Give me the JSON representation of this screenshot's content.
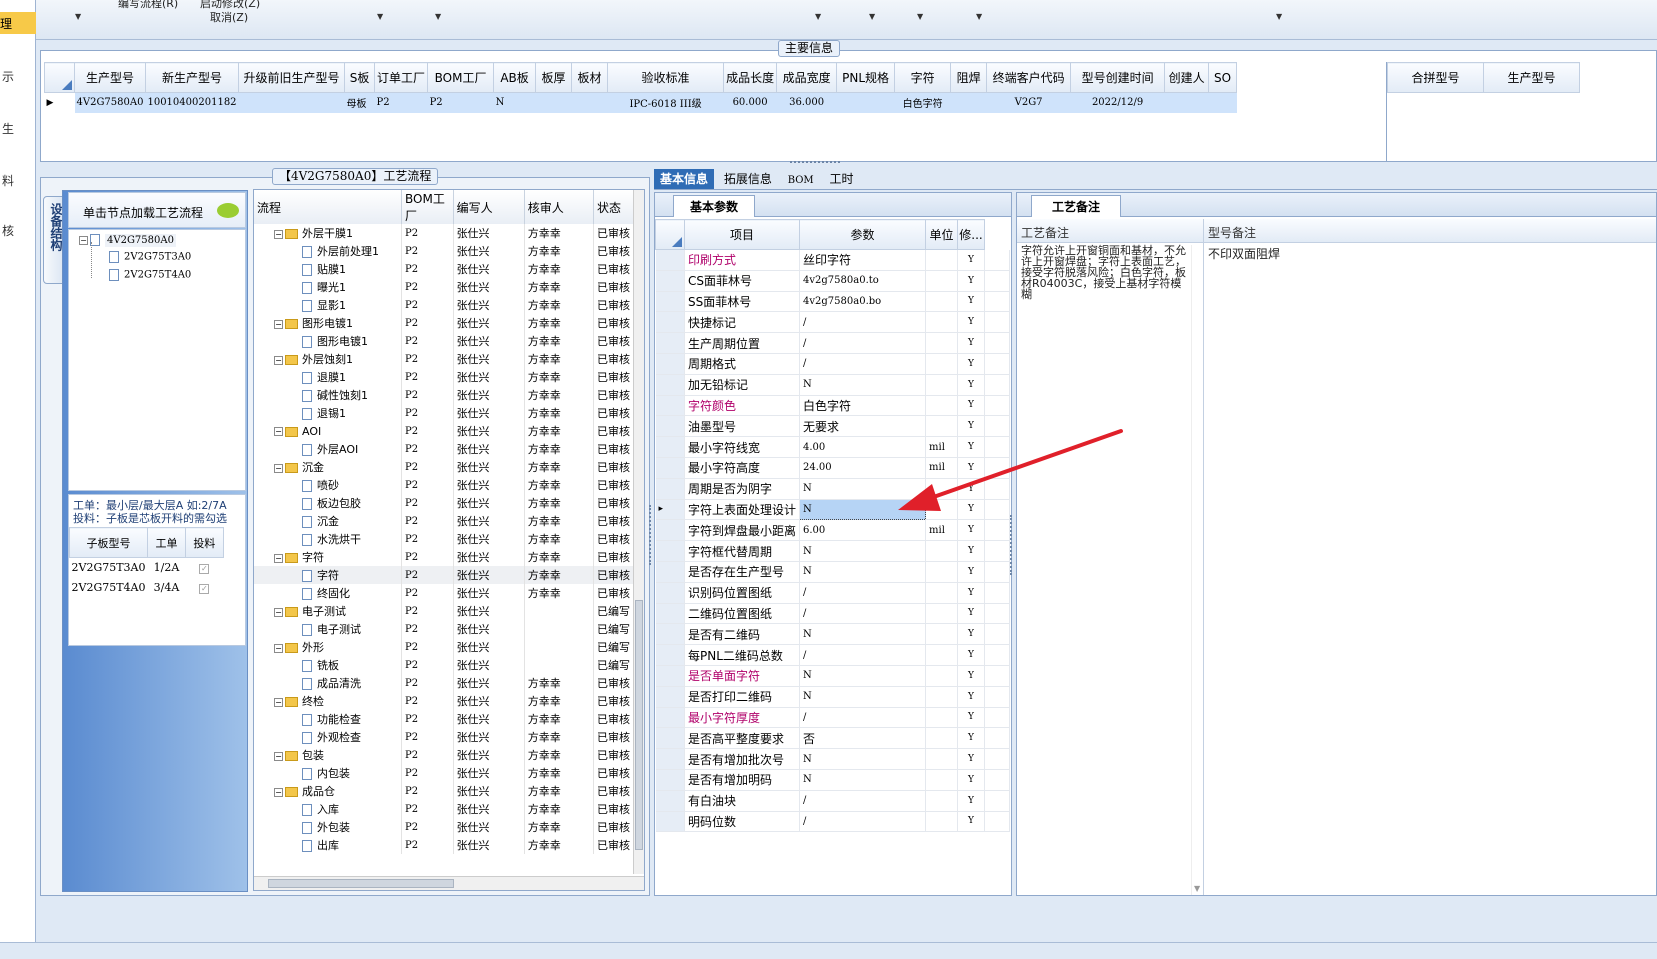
{
  "menu": {
    "items": [
      "编写流程(R)",
      "启动修改(Z)",
      "取消(Z)"
    ]
  },
  "sidebar": {
    "selected": "理",
    "items": [
      "示",
      "生",
      "料",
      "核"
    ]
  },
  "main_info": {
    "title": "主要信息",
    "columns": [
      "生产型号",
      "新生产型号",
      "升级前旧生产型号",
      "S板",
      "订单工厂",
      "BOM工厂",
      "AB板",
      "板厚",
      "板材",
      "验收标准",
      "成品长度",
      "成品宽度",
      "PNL规格",
      "字符",
      "阻焊",
      "终端客户代码",
      "型号创建时间",
      "创建人",
      "SO"
    ],
    "row": [
      "4V2G7580A0",
      "10010400201182",
      "",
      "母板",
      "P2",
      "P2",
      "N",
      "",
      "",
      "IPC-6018 III级",
      "60.000",
      "36.000",
      "",
      "白色字符",
      "",
      "V2G7",
      "2022/12/9",
      "",
      ""
    ],
    "right_columns": [
      "合拼型号",
      "生产型号"
    ]
  },
  "left_panel": {
    "tab": "设备结构",
    "header": "单击节点加载工艺流程",
    "tree": [
      "4V2G7580A0",
      "2V2G75T3A0",
      "2V2G75T4A0"
    ],
    "note_line1": "工单：最小层/最大层A 如:2/7A",
    "note_line2": "投料：子板是芯板开料的需勾选",
    "sub_columns": [
      "子板型号",
      "工单",
      "投料"
    ],
    "sub_rows": [
      [
        "2V2G75T3A0",
        "1/2A"
      ],
      [
        "2V2G75T4A0",
        "3/4A"
      ]
    ]
  },
  "flow": {
    "title": "【4V2G7580A0】工艺流程",
    "columns": [
      "流程",
      "BOM工厂",
      "编写人",
      "核审人",
      "状态"
    ],
    "rows": [
      {
        "name": "外层干膜1",
        "folder": true,
        "bom": "P2",
        "writer": "张仕兴",
        "reviewer": "方幸幸",
        "status": "已审核"
      },
      {
        "name": "外层前处理1",
        "folder": false,
        "bom": "P2",
        "writer": "张仕兴",
        "reviewer": "方幸幸",
        "status": "已审核"
      },
      {
        "name": "贴膜1",
        "folder": false,
        "bom": "P2",
        "writer": "张仕兴",
        "reviewer": "方幸幸",
        "status": "已审核"
      },
      {
        "name": "曝光1",
        "folder": false,
        "bom": "P2",
        "writer": "张仕兴",
        "reviewer": "方幸幸",
        "status": "已审核"
      },
      {
        "name": "显影1",
        "folder": false,
        "bom": "P2",
        "writer": "张仕兴",
        "reviewer": "方幸幸",
        "status": "已审核"
      },
      {
        "name": "图形电镀1",
        "folder": true,
        "bom": "P2",
        "writer": "张仕兴",
        "reviewer": "方幸幸",
        "status": "已审核"
      },
      {
        "name": "图形电镀1",
        "folder": false,
        "bom": "P2",
        "writer": "张仕兴",
        "reviewer": "方幸幸",
        "status": "已审核"
      },
      {
        "name": "外层蚀刻1",
        "folder": true,
        "bom": "P2",
        "writer": "张仕兴",
        "reviewer": "方幸幸",
        "status": "已审核"
      },
      {
        "name": "退膜1",
        "folder": false,
        "bom": "P2",
        "writer": "张仕兴",
        "reviewer": "方幸幸",
        "status": "已审核"
      },
      {
        "name": "碱性蚀刻1",
        "folder": false,
        "bom": "P2",
        "writer": "张仕兴",
        "reviewer": "方幸幸",
        "status": "已审核"
      },
      {
        "name": "退锡1",
        "folder": false,
        "bom": "P2",
        "writer": "张仕兴",
        "reviewer": "方幸幸",
        "status": "已审核"
      },
      {
        "name": "AOI",
        "folder": true,
        "bom": "P2",
        "writer": "张仕兴",
        "reviewer": "方幸幸",
        "status": "已审核"
      },
      {
        "name": "外层AOI",
        "folder": false,
        "bom": "P2",
        "writer": "张仕兴",
        "reviewer": "方幸幸",
        "status": "已审核"
      },
      {
        "name": "沉金",
        "folder": true,
        "bom": "P2",
        "writer": "张仕兴",
        "reviewer": "方幸幸",
        "status": "已审核"
      },
      {
        "name": "喷砂",
        "folder": false,
        "bom": "P2",
        "writer": "张仕兴",
        "reviewer": "方幸幸",
        "status": "已审核"
      },
      {
        "name": "板边包胶",
        "folder": false,
        "bom": "P2",
        "writer": "张仕兴",
        "reviewer": "方幸幸",
        "status": "已审核"
      },
      {
        "name": "沉金",
        "folder": false,
        "bom": "P2",
        "writer": "张仕兴",
        "reviewer": "方幸幸",
        "status": "已审核"
      },
      {
        "name": "水洗烘干",
        "folder": false,
        "bom": "P2",
        "writer": "张仕兴",
        "reviewer": "方幸幸",
        "status": "已审核"
      },
      {
        "name": "字符",
        "folder": true,
        "bom": "P2",
        "writer": "张仕兴",
        "reviewer": "方幸幸",
        "status": "已审核"
      },
      {
        "name": "字符",
        "folder": false,
        "bom": "P2",
        "writer": "张仕兴",
        "reviewer": "方幸幸",
        "status": "已审核"
      },
      {
        "name": "终固化",
        "folder": false,
        "bom": "P2",
        "writer": "张仕兴",
        "reviewer": "方幸幸",
        "status": "已审核"
      },
      {
        "name": "电子测试",
        "folder": true,
        "bom": "P2",
        "writer": "张仕兴",
        "reviewer": "",
        "status": "已编写"
      },
      {
        "name": "电子测试",
        "folder": false,
        "bom": "P2",
        "writer": "张仕兴",
        "reviewer": "",
        "status": "已编写"
      },
      {
        "name": "外形",
        "folder": true,
        "bom": "P2",
        "writer": "张仕兴",
        "reviewer": "",
        "status": "已编写"
      },
      {
        "name": "铣板",
        "folder": false,
        "bom": "P2",
        "writer": "张仕兴",
        "reviewer": "",
        "status": "已编写"
      },
      {
        "name": "成品清洗",
        "folder": false,
        "bom": "P2",
        "writer": "张仕兴",
        "reviewer": "方幸幸",
        "status": "已审核"
      },
      {
        "name": "终检",
        "folder": true,
        "bom": "P2",
        "writer": "张仕兴",
        "reviewer": "方幸幸",
        "status": "已审核"
      },
      {
        "name": "功能检查",
        "folder": false,
        "bom": "P2",
        "writer": "张仕兴",
        "reviewer": "方幸幸",
        "status": "已审核"
      },
      {
        "name": "外观检查",
        "folder": false,
        "bom": "P2",
        "writer": "张仕兴",
        "reviewer": "方幸幸",
        "status": "已审核"
      },
      {
        "name": "包装",
        "folder": true,
        "bom": "P2",
        "writer": "张仕兴",
        "reviewer": "方幸幸",
        "status": "已审核"
      },
      {
        "name": "内包装",
        "folder": false,
        "bom": "P2",
        "writer": "张仕兴",
        "reviewer": "方幸幸",
        "status": "已审核"
      },
      {
        "name": "成品仓",
        "folder": true,
        "bom": "P2",
        "writer": "张仕兴",
        "reviewer": "方幸幸",
        "status": "已审核"
      },
      {
        "name": "入库",
        "folder": false,
        "bom": "P2",
        "writer": "张仕兴",
        "reviewer": "方幸幸",
        "status": "已审核"
      },
      {
        "name": "外包装",
        "folder": false,
        "bom": "P2",
        "writer": "张仕兴",
        "reviewer": "方幸幸",
        "status": "已审核"
      },
      {
        "name": "出库",
        "folder": false,
        "bom": "P2",
        "writer": "张仕兴",
        "reviewer": "方幸幸",
        "status": "已审核"
      }
    ]
  },
  "detail_tabs": [
    "基本信息",
    "拓展信息",
    "BOM",
    "工时"
  ],
  "basic": {
    "tab": "基本参数",
    "columns": [
      "项目",
      "参数",
      "单位",
      "修..."
    ],
    "rows": [
      {
        "item": "印刷方式",
        "param": "丝印字符",
        "unit": "",
        "mod": "Y",
        "pink": true
      },
      {
        "item": "CS面菲林号",
        "param": "4v2g7580a0.to",
        "unit": "",
        "mod": "Y",
        "pink": false
      },
      {
        "item": "SS面菲林号",
        "param": "4v2g7580a0.bo",
        "unit": "",
        "mod": "Y",
        "pink": false
      },
      {
        "item": "快捷标记",
        "param": "/",
        "unit": "",
        "mod": "Y",
        "pink": false
      },
      {
        "item": "生产周期位置",
        "param": "/",
        "unit": "",
        "mod": "Y",
        "pink": false
      },
      {
        "item": "周期格式",
        "param": "/",
        "unit": "",
        "mod": "Y",
        "pink": false
      },
      {
        "item": "加无铅标记",
        "param": "N",
        "unit": "",
        "mod": "Y",
        "pink": false
      },
      {
        "item": "字符颜色",
        "param": "白色字符",
        "unit": "",
        "mod": "Y",
        "pink": true
      },
      {
        "item": "油墨型号",
        "param": "无要求",
        "unit": "",
        "mod": "Y",
        "pink": false
      },
      {
        "item": "最小字符线宽",
        "param": "4.00",
        "unit": "mil",
        "mod": "Y",
        "pink": false
      },
      {
        "item": "最小字符高度",
        "param": "24.00",
        "unit": "mil",
        "mod": "Y",
        "pink": false
      },
      {
        "item": "周期是否为阴字",
        "param": "N",
        "unit": "",
        "mod": "Y",
        "pink": false
      },
      {
        "item": "字符上表面处理设计",
        "param": "N",
        "unit": "",
        "mod": "Y",
        "pink": false
      },
      {
        "item": "字符到焊盘最小距离",
        "param": "6.00",
        "unit": "mil",
        "mod": "Y",
        "pink": false
      },
      {
        "item": "字符框代替周期",
        "param": "N",
        "unit": "",
        "mod": "Y",
        "pink": false
      },
      {
        "item": "是否存在生产型号",
        "param": "N",
        "unit": "",
        "mod": "Y",
        "pink": false
      },
      {
        "item": "识别码位置图纸",
        "param": "/",
        "unit": "",
        "mod": "Y",
        "pink": false
      },
      {
        "item": "二维码位置图纸",
        "param": "/",
        "unit": "",
        "mod": "Y",
        "pink": false
      },
      {
        "item": "是否有二维码",
        "param": "N",
        "unit": "",
        "mod": "Y",
        "pink": false
      },
      {
        "item": "每PNL二维码总数",
        "param": "/",
        "unit": "",
        "mod": "Y",
        "pink": false
      },
      {
        "item": "是否单面字符",
        "param": "N",
        "unit": "",
        "mod": "Y",
        "pink": true
      },
      {
        "item": "是否打印二维码",
        "param": "N",
        "unit": "",
        "mod": "Y",
        "pink": false
      },
      {
        "item": "最小字符厚度",
        "param": "/",
        "unit": "",
        "mod": "Y",
        "pink": true
      },
      {
        "item": "是否高平整度要求",
        "param": "否",
        "unit": "",
        "mod": "Y",
        "pink": false
      },
      {
        "item": "是否有增加批次号",
        "param": "N",
        "unit": "",
        "mod": "Y",
        "pink": false
      },
      {
        "item": "是否有增加明码",
        "param": "N",
        "unit": "",
        "mod": "Y",
        "pink": false
      },
      {
        "item": "有白油块",
        "param": "/",
        "unit": "",
        "mod": "Y",
        "pink": false
      },
      {
        "item": "明码位数",
        "param": "/",
        "unit": "",
        "mod": "Y",
        "pink": false
      }
    ]
  },
  "remark": {
    "tab": "工艺备注",
    "columns": [
      "工艺备注",
      "型号备注"
    ],
    "process_note": "字符允许上开窗铜面和基材，不允许上开窗焊盘；字符上表面工艺，接受字符脱落风险；白色字符，板材R04003C，接受上基材字符模糊",
    "model_note": "不印双面阻焊"
  },
  "colors": {
    "accent": "#e0202a",
    "selected_row": "#cfe3fb",
    "pink_label": "#b0006a"
  }
}
